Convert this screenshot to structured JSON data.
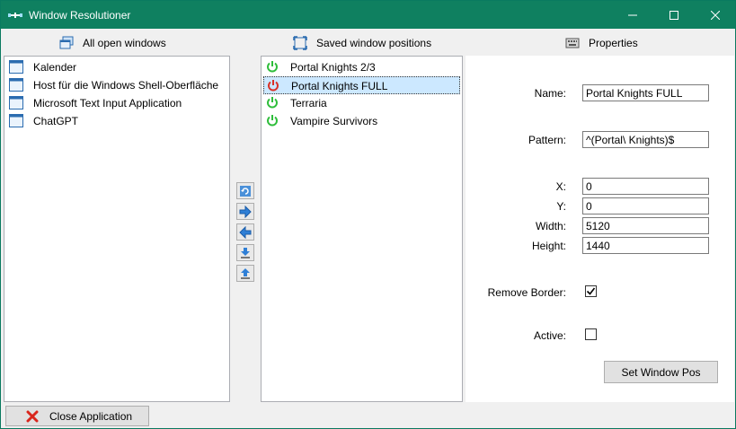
{
  "window": {
    "title": "Window Resolutioner"
  },
  "columns": {
    "all_open": "All open windows",
    "saved": "Saved window positions",
    "properties": "Properties"
  },
  "open_windows": [
    {
      "label": "Kalender"
    },
    {
      "label": "Host für die Windows Shell-Oberfläche"
    },
    {
      "label": "Microsoft Text Input Application"
    },
    {
      "label": "ChatGPT"
    }
  ],
  "saved_positions": [
    {
      "label": "Portal Knights 2/3",
      "state": "active",
      "color": "#2ebd3a"
    },
    {
      "label": "Portal Knights FULL",
      "state": "inactive",
      "color": "#d93025",
      "selected": true
    },
    {
      "label": "Terraria",
      "state": "active",
      "color": "#2ebd3a"
    },
    {
      "label": "Vampire Survivors",
      "state": "active",
      "color": "#2ebd3a"
    }
  ],
  "properties": {
    "name_label": "Name:",
    "name_value": "Portal Knights FULL",
    "pattern_label": "Pattern:",
    "pattern_value": "^(Portal\\ Knights)$",
    "x_label": "X:",
    "x_value": "0",
    "y_label": "Y:",
    "y_value": "0",
    "width_label": "Width:",
    "width_value": "5120",
    "height_label": "Height:",
    "height_value": "1440",
    "remove_border_label": "Remove Border:",
    "remove_border_checked": true,
    "active_label": "Active:",
    "active_checked": false,
    "set_button": "Set Window Pos"
  },
  "footer": {
    "close_button": "Close Application"
  },
  "colors": {
    "titlebar": "#0f8060",
    "selection": "#cce8ff",
    "active_power": "#2ebd3a",
    "inactive_power": "#d93025"
  }
}
